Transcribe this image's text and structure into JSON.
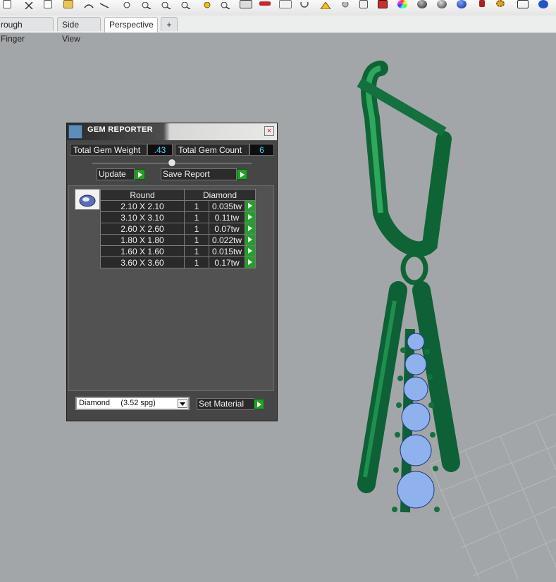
{
  "toolbar": {
    "icons": [
      "new-file-icon",
      "cut-icon",
      "copy-icon",
      "paste-icon",
      "undo-icon",
      "redo-icon",
      "pan-icon",
      "zoom-icon",
      "zoom-window-icon",
      "zoom-extents-icon",
      "zoom-selected-icon",
      "rotate-icon",
      "lock-icon",
      "layer-icon",
      "car-icon",
      "printer-icon",
      "refresh-icon",
      "warning-icon",
      "light-bulb-icon",
      "object-icon",
      "material-icon",
      "color-wheel-icon",
      "sphere-icon",
      "sphere-render-icon",
      "globe-icon",
      "gear-icon",
      "grid-snap-icon",
      "help-icon"
    ]
  },
  "tabs": [
    {
      "label": "rough Finger"
    },
    {
      "label": "Side View"
    },
    {
      "label": "Perspective"
    },
    {
      "label": "+"
    }
  ],
  "gem_reporter": {
    "title": "GEM REPORTER",
    "close": "×",
    "total_weight_label": "Total Gem Weight",
    "total_weight_value": ".43",
    "total_count_label": "Total Gem Count",
    "total_count_value": "6",
    "update_label": "Update",
    "save_report_label": "Save Report",
    "table": {
      "headers": [
        "Round",
        "Diamond"
      ],
      "rows": [
        {
          "size": "2.10 X 2.10",
          "qty": "1",
          "weight": "0.035tw"
        },
        {
          "size": "3.10 X 3.10",
          "qty": "1",
          "weight": "0.11tw"
        },
        {
          "size": "2.60 X 2.60",
          "qty": "1",
          "weight": "0.07tw"
        },
        {
          "size": "1.80 X 1.80",
          "qty": "1",
          "weight": "0.022tw"
        },
        {
          "size": "1.60 X 1.60",
          "qty": "1",
          "weight": "0.015tw"
        },
        {
          "size": "3.60 X 3.60",
          "qty": "1",
          "weight": "0.17tw"
        }
      ]
    },
    "material_select": "Diamond     (3.52 spg)",
    "set_material_label": "Set Material"
  },
  "colors": {
    "jewelry_green": "#126b3c",
    "gem_blue": "#8fb2ef",
    "viewport_bg": "#a3a6a9",
    "accent_green_button": "#22a02a"
  }
}
